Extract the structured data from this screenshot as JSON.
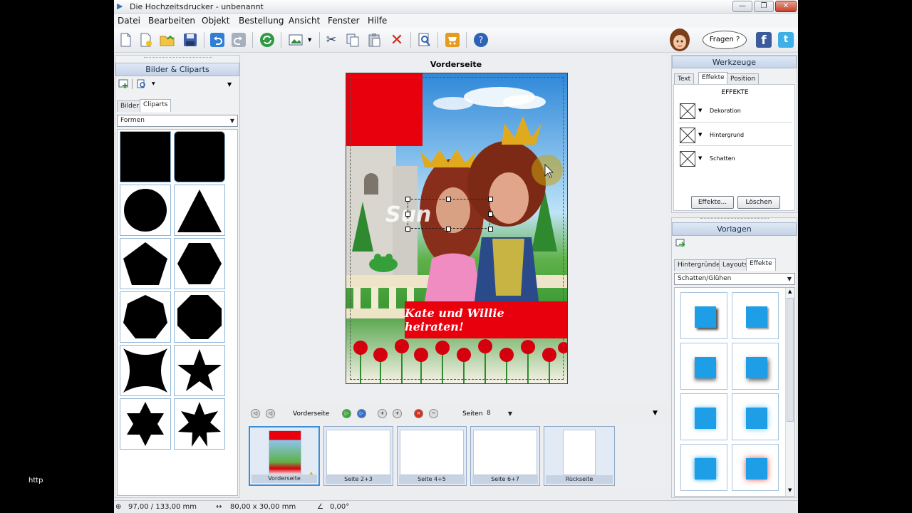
{
  "window": {
    "title": "Die Hochzeitsdrucker - unbenannt",
    "minimize": "—",
    "maximize": "❐",
    "close": "✕"
  },
  "menu": [
    "Datei",
    "Bearbeiten",
    "Objekt",
    "Bestellung",
    "Ansicht",
    "Fenster",
    "Hilfe"
  ],
  "help": {
    "bubble": "Fragen ?"
  },
  "left_panel": {
    "title": "Bilder & Cliparts",
    "tabs": [
      "Bilder",
      "Cliparts"
    ],
    "category": "Formen"
  },
  "canvas": {
    "title": "Vorderseite",
    "banner_text": "Kate und Willie heiraten!",
    "selected_text": "Sun"
  },
  "pages_bar": {
    "current": "Vorderseite",
    "pages_label": "Seiten",
    "pages_value": "8",
    "thumbnails": [
      "Vorderseite",
      "Seite 2+3",
      "Seite 4+5",
      "Seite 6+7",
      "Rückseite"
    ]
  },
  "tools_panel": {
    "title": "Werkzeuge",
    "tabs": [
      "Text",
      "Effekte",
      "Position"
    ],
    "heading": "EFFEKTE",
    "rows": [
      "Dekoration",
      "Hintergrund",
      "Schatten"
    ],
    "buttons": [
      "Effekte...",
      "Löschen"
    ]
  },
  "templates_panel": {
    "title": "Vorlagen",
    "tabs": [
      "Hintergründe",
      "Layouts",
      "Effekte"
    ],
    "category": "Schatten/Glühen"
  },
  "status": {
    "position": "97,00 / 133,00 mm",
    "size": "80,00 x 30,00 mm",
    "angle": "0,00°"
  },
  "desktop_label": "http",
  "colors": {
    "accent_red": "#e8000d",
    "panel_blue": "#c5d3e8",
    "template_blue": "#1d9ee6"
  }
}
